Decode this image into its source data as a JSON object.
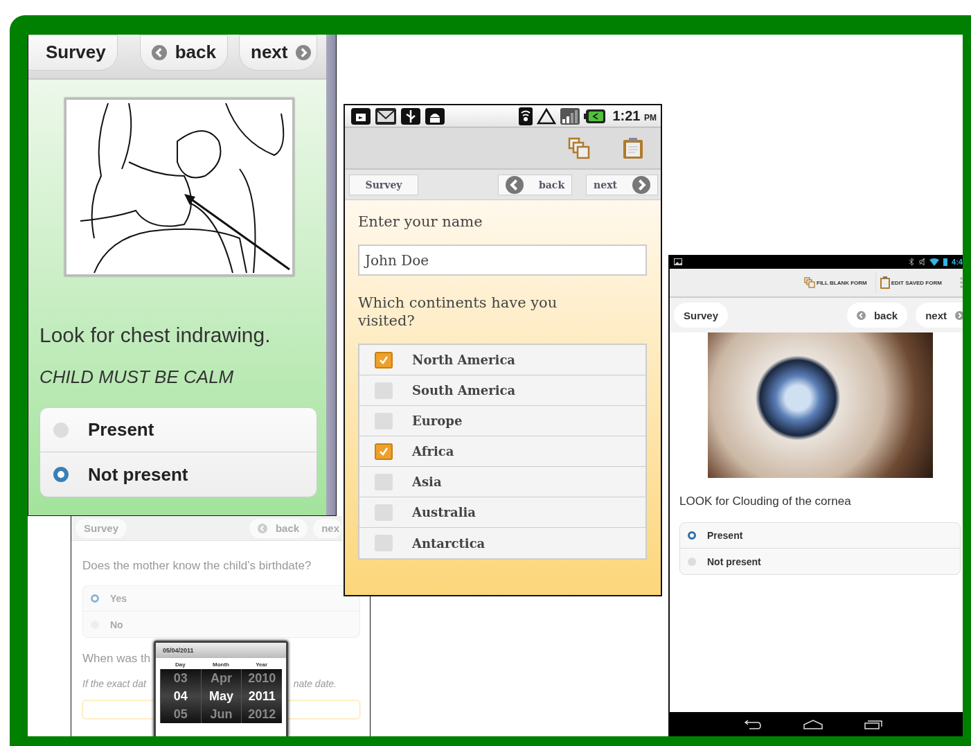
{
  "left_screen": {
    "nav": {
      "title": "Survey",
      "back": "back",
      "next": "next"
    },
    "question": "Look for chest indrawing.",
    "hint": "CHILD MUST BE CALM",
    "options": [
      {
        "label": "Present",
        "selected": false
      },
      {
        "label": "Not present",
        "selected": true
      }
    ]
  },
  "back_screen": {
    "nav": {
      "title": "Survey",
      "back": "back",
      "next": "nex"
    },
    "question": "Does the mother know the child’s birthdate?",
    "options": [
      {
        "label": "Yes",
        "selected": true
      },
      {
        "label": "No",
        "selected": false
      }
    ],
    "question_2": "When was th",
    "hint_start": "If the exact dat",
    "hint_end": "nate date.",
    "date_picker": {
      "title": "05/04/2011",
      "columns": [
        {
          "heading": "Day",
          "values": [
            {
              "text": "03",
              "selected": false
            },
            {
              "text": "04",
              "selected": true
            },
            {
              "text": "05",
              "selected": false
            }
          ]
        },
        {
          "heading": "Month",
          "values": [
            {
              "text": "Apr",
              "selected": false
            },
            {
              "text": "May",
              "selected": true
            },
            {
              "text": "Jun",
              "selected": false
            }
          ]
        },
        {
          "heading": "Year",
          "values": [
            {
              "text": "2010",
              "selected": false
            },
            {
              "text": "2011",
              "selected": true
            },
            {
              "text": "2012",
              "selected": false
            }
          ]
        }
      ]
    }
  },
  "middle_screen": {
    "status_bar": {
      "time": "1:21",
      "am_pm": "PM"
    },
    "nav": {
      "title": "Survey",
      "back": "back",
      "next": "next"
    },
    "name_label": "Enter your name",
    "name_value": "John Doe",
    "continents_label": "Which continents have you visited?",
    "continents": [
      {
        "label": "North America",
        "checked": true
      },
      {
        "label": "South America",
        "checked": false
      },
      {
        "label": "Europe",
        "checked": false
      },
      {
        "label": "Africa",
        "checked": true
      },
      {
        "label": "Asia",
        "checked": false
      },
      {
        "label": "Australia",
        "checked": false
      },
      {
        "label": "Antarctica",
        "checked": false
      }
    ]
  },
  "right_screen": {
    "status_bar": {
      "time": "4:4"
    },
    "actions": [
      "FILL BLANK FORM",
      "EDIT SAVED FORM"
    ],
    "nav": {
      "title": "Survey",
      "back": "back",
      "next": "next"
    },
    "question": "LOOK for Clouding of the cornea",
    "options": [
      {
        "label": "Present",
        "selected": true
      },
      {
        "label": "Not present",
        "selected": false
      }
    ]
  }
}
